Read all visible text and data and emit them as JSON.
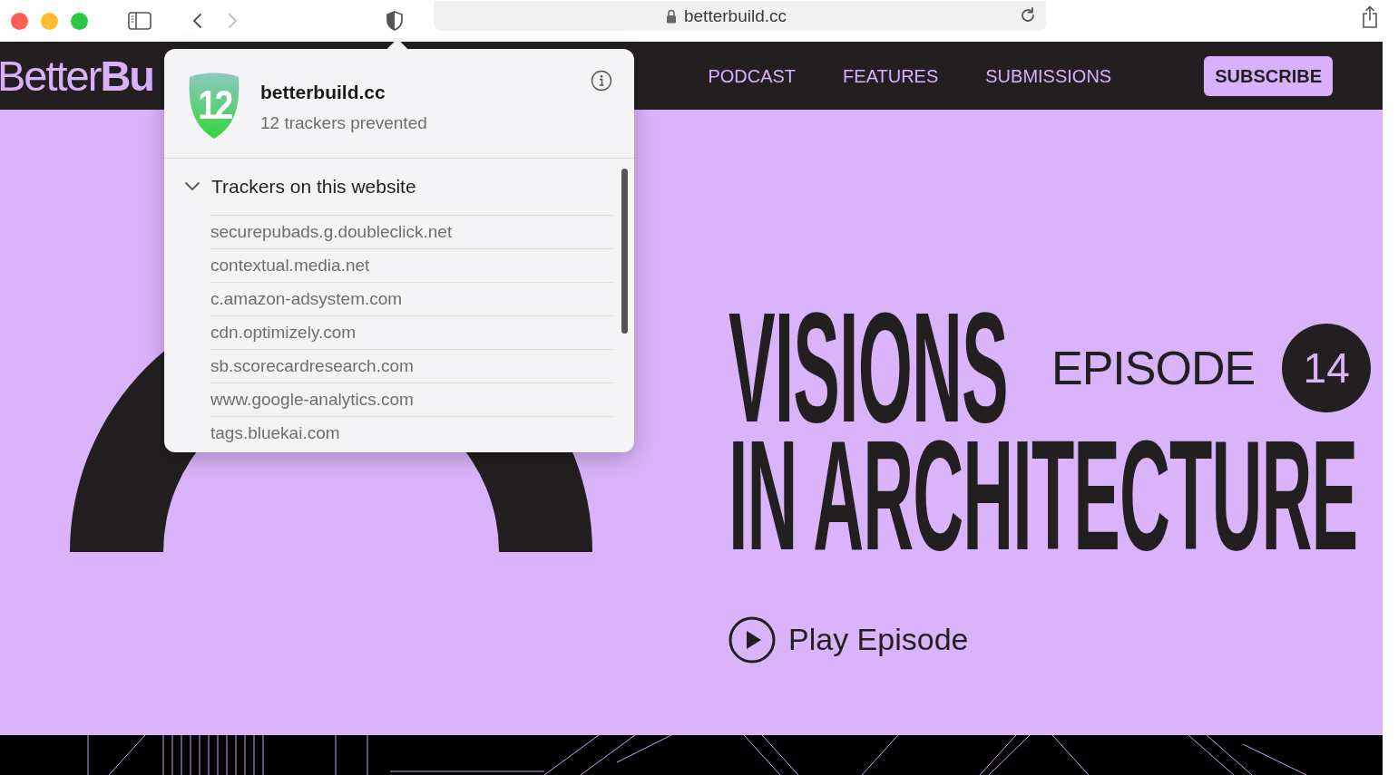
{
  "toolbar": {
    "nav_buttons": [
      {
        "kind": "back",
        "disabled": false
      },
      {
        "kind": "forward",
        "disabled": true
      }
    ],
    "url": "betterbuild.cc"
  },
  "site": {
    "logo": "Better**Bu**",
    "nav": [
      "PODCAST",
      "FEATURES",
      "SUBMISSIONS"
    ],
    "subscribe": "SUBSCRIBE"
  },
  "hero": {
    "title_line_1": "VISIONS",
    "episode_label": "EPISODE",
    "episode_number": "14",
    "title_line_2": "IN ARCHITECTURE",
    "play": "Play Episode"
  },
  "privacy_popup": {
    "count": "12",
    "site": "betterbuild.cc",
    "summary": "12 trackers prevented",
    "section": {
      "title": "Trackers on this website",
      "expanded": true,
      "items": [
        "securepubads.g.doubleclick.net",
        "contextual.media.net",
        "c.amazon-adsystem.com",
        "cdn.optimizely.com",
        "sb.scorecardresearch.com",
        "www.google-analytics.com",
        "tags.bluekai.com"
      ]
    }
  }
}
